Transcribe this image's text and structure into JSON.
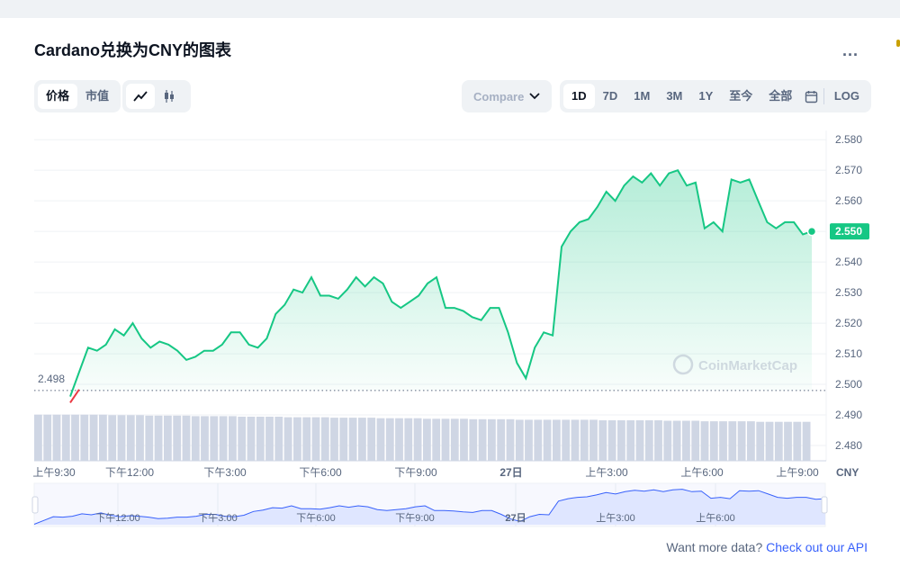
{
  "title": "Cardano兑换为CNY的图表",
  "more_label": "...",
  "view_tabs": [
    {
      "label": "价格",
      "active": true
    },
    {
      "label": "市值",
      "active": false
    }
  ],
  "chart_type_icons": [
    {
      "icon": "line-chart-icon",
      "active": true
    },
    {
      "icon": "candlestick-icon",
      "active": false
    }
  ],
  "compare_label": "Compare with",
  "range_tabs": [
    {
      "label": "1D",
      "active": true
    },
    {
      "label": "7D",
      "active": false
    },
    {
      "label": "1M",
      "active": false
    },
    {
      "label": "3M",
      "active": false
    },
    {
      "label": "1Y",
      "active": false
    },
    {
      "label": "至今",
      "active": false
    },
    {
      "label": "全部",
      "active": false
    }
  ],
  "calendar_icon": "calendar-icon",
  "log_label": "LOG",
  "watermark": "CoinMarketCap",
  "footer": {
    "text": "Want more data? ",
    "link": "Check out our API"
  },
  "colors": {
    "line": "#16c784",
    "open_line": "#ea3943",
    "current_badge": "#16c784",
    "volume": "#cfd6e4",
    "navigator_fill": "#dfe6ff",
    "navigator_line": "#3861fb"
  },
  "chart_data": {
    "type": "line",
    "y_axis": {
      "min": 2.475,
      "max": 2.583,
      "ticks": [
        "2.580",
        "2.570",
        "2.560",
        "2.550",
        "2.540",
        "2.530",
        "2.520",
        "2.510",
        "2.500",
        "2.490",
        "2.480"
      ],
      "unit": "CNY"
    },
    "x_ticks": [
      "上午9:30",
      "下午12:00",
      "下午3:00",
      "下午6:00",
      "下午9:00",
      "27日",
      "上午3:00",
      "上午6:00",
      "上午9:00"
    ],
    "open_price_label": "2.498",
    "open_price": 2.498,
    "current_price_label": "2.550",
    "current_price": 2.55,
    "series": [
      {
        "values": [
          2.496,
          2.504,
          2.512,
          2.511,
          2.513,
          2.518,
          2.516,
          2.52,
          2.515,
          2.512,
          2.514,
          2.513,
          2.511,
          2.508,
          2.509,
          2.511,
          2.511,
          2.513,
          2.517,
          2.517,
          2.513,
          2.512,
          2.515,
          2.523,
          2.526,
          2.531,
          2.53,
          2.535,
          2.529,
          2.529,
          2.528,
          2.531,
          2.535,
          2.532,
          2.535,
          2.533,
          2.527,
          2.525,
          2.527,
          2.529,
          2.533,
          2.535,
          2.525,
          2.525,
          2.524,
          2.522,
          2.521,
          2.525,
          2.525,
          2.517,
          2.507,
          2.502,
          2.512,
          2.517,
          2.516,
          2.545,
          2.55,
          2.553,
          2.554,
          2.558,
          2.563,
          2.56,
          2.565,
          2.568,
          2.566,
          2.569,
          2.565,
          2.569,
          2.57,
          2.565,
          2.566,
          2.551,
          2.553,
          2.55,
          2.567,
          2.566,
          2.567,
          2.56,
          2.553,
          2.551,
          2.553,
          2.553,
          2.549,
          2.55
        ]
      }
    ],
    "volume": [
      0.9,
      0.9,
      0.9,
      0.9,
      0.9,
      0.9,
      0.9,
      0.9,
      0.89,
      0.89,
      0.89,
      0.89,
      0.88,
      0.88,
      0.88,
      0.88,
      0.88,
      0.87,
      0.87,
      0.87,
      0.87,
      0.87,
      0.86,
      0.86,
      0.86,
      0.86,
      0.86,
      0.85,
      0.85,
      0.85,
      0.85,
      0.85,
      0.84,
      0.84,
      0.84,
      0.84,
      0.84,
      0.83,
      0.83,
      0.83,
      0.83,
      0.83,
      0.82,
      0.82,
      0.82,
      0.82,
      0.82,
      0.81,
      0.81,
      0.81,
      0.81,
      0.81,
      0.8,
      0.8,
      0.8,
      0.8,
      0.8,
      0.8,
      0.8,
      0.8,
      0.8,
      0.79,
      0.79,
      0.79,
      0.79,
      0.79,
      0.79,
      0.79,
      0.78,
      0.78,
      0.78,
      0.78,
      0.77,
      0.77,
      0.77,
      0.77,
      0.77,
      0.77,
      0.76,
      0.76,
      0.76,
      0.76,
      0.76,
      0.76
    ],
    "navigator_ticks": [
      "下午12:00",
      "下午3:00",
      "下午6:00",
      "下午9:00",
      "27日",
      "上午3:00",
      "上午6:00"
    ],
    "grid": true,
    "legend": "none"
  }
}
